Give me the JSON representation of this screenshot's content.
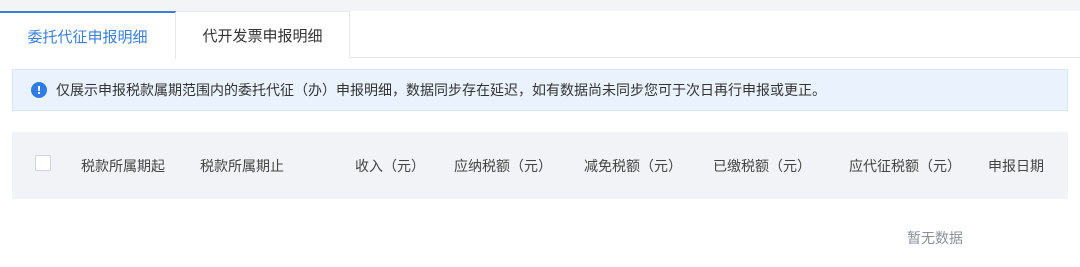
{
  "tabs": [
    {
      "label": "委托代征申报明细",
      "active": true
    },
    {
      "label": "代开发票申报明细",
      "active": false
    }
  ],
  "notice": {
    "icon": "info-icon",
    "text": "仅展示申报税款属期范围内的委托代征（办）申报明细，数据同步存在延迟，如有数据尚未同步您可于次日再行申报或更正。"
  },
  "table": {
    "columns": [
      "税款所属期起",
      "税款所属期止",
      "收入（元）",
      "应纳税额（元）",
      "减免税额（元）",
      "已缴税额（元）",
      "应代征税额（元）",
      "申报日期"
    ],
    "empty_text": "暂无数据"
  },
  "colors": {
    "accent": "#3b7fd9",
    "notice_bg": "#eaf3fd",
    "header_bg": "#f1f3f6"
  }
}
